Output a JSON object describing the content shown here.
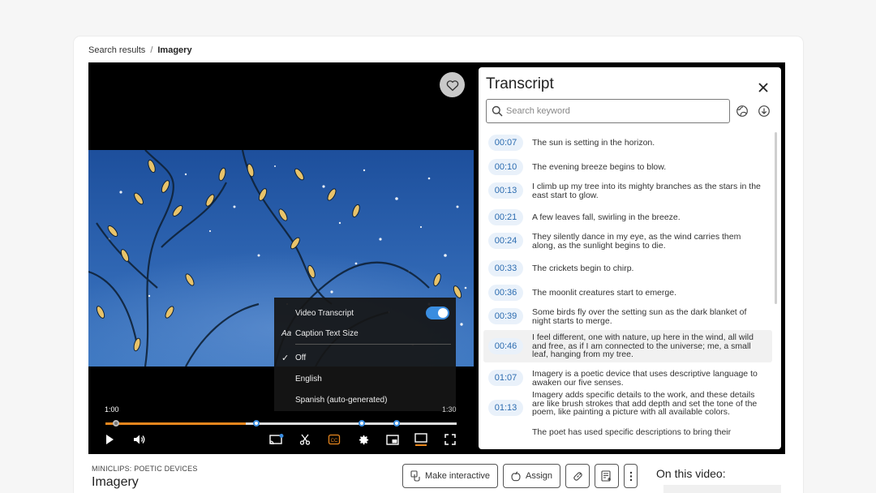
{
  "breadcrumb": {
    "parent": "Search results",
    "separator": "/",
    "current": "Imagery"
  },
  "player": {
    "time_current": "1:00",
    "time_total": "1:30",
    "progress_fraction": 0.4,
    "head_fraction": 0.03,
    "markers_fraction": [
      0.43,
      0.73,
      0.83
    ],
    "controls": [
      "play-icon",
      "volume-icon",
      "cast-icon",
      "scissors-icon",
      "cc-icon",
      "settings-icon",
      "pip-icon",
      "theater-icon",
      "fullscreen-icon"
    ]
  },
  "settings_menu": {
    "video_transcript": "Video Transcript",
    "video_transcript_on": true,
    "caption_prefix": "Aa",
    "caption_text_size": "Caption Text Size",
    "options": [
      {
        "label": "Off",
        "selected": true
      },
      {
        "label": "English",
        "selected": false
      },
      {
        "label": "Spanish (auto-generated)",
        "selected": false
      }
    ]
  },
  "transcript": {
    "title": "Transcript",
    "search_placeholder": "Search keyword",
    "rows": [
      {
        "time": "00:07",
        "text": "The sun is setting in the horizon."
      },
      {
        "time": "00:10",
        "text": "The evening breeze begins to blow."
      },
      {
        "time": "00:13",
        "text": "I climb up my tree into its mighty branches as the stars in the east start to glow."
      },
      {
        "time": "00:21",
        "text": "A few leaves fall, swirling in the breeze."
      },
      {
        "time": "00:24",
        "text": "They silently dance in my eye, as the wind carries them along, as the sunlight begins to die."
      },
      {
        "time": "00:33",
        "text": "The crickets begin to chirp."
      },
      {
        "time": "00:36",
        "text": "The moonlit creatures start to emerge."
      },
      {
        "time": "00:39",
        "text": "Some birds fly over the setting sun as the dark blanket of night starts to merge."
      },
      {
        "time": "00:46",
        "text": "I feel different, one with nature, up here in the wind, all wild and free, as if I am connected to the universe; me, a small leaf, hanging from my tree."
      },
      {
        "time": "01:07",
        "text": "Imagery is a poetic device that uses descriptive language to awaken our five senses."
      },
      {
        "time": "01:13",
        "text": "Imagery adds specific details to the work, and these details are like brush strokes that add depth and set the tone of the poem, like painting a picture with all available colors."
      },
      {
        "time": "",
        "text": "The poet has used specific descriptions to bring their"
      }
    ]
  },
  "video_info": {
    "kicker": "MINICLIPS: POETIC DEVICES",
    "title": "Imagery",
    "make_interactive": "Make interactive",
    "assign": "Assign",
    "on_this_video": "On this video:"
  },
  "colors": {
    "accent": "#3a8de0",
    "progress": "#e8871e",
    "timestamp_bg": "#e9f1fa",
    "timestamp_text": "#2c6cb0"
  }
}
